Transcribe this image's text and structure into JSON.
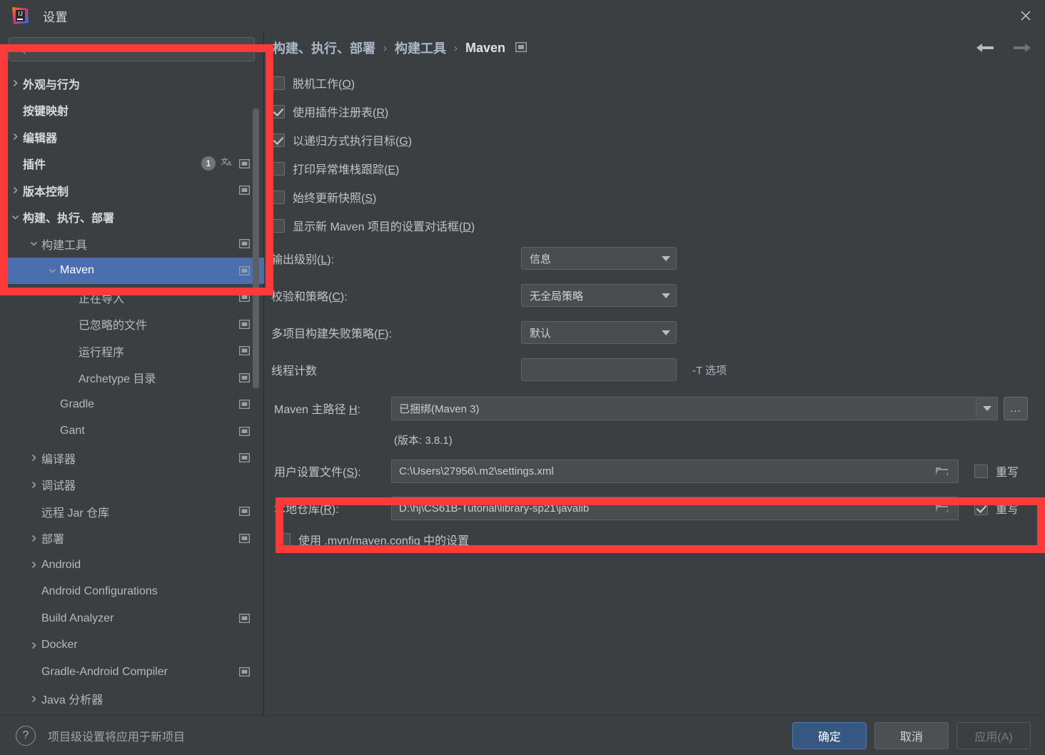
{
  "window": {
    "title": "设置",
    "close_icon": "close-icon",
    "logo": "intellij-idea-logo"
  },
  "sidebar": {
    "search": {
      "placeholder": "",
      "value": "",
      "icon": "search-icon"
    },
    "items": [
      {
        "label": "外观与行为",
        "indent": 0,
        "arrow": "collapsed",
        "bold": true,
        "badge": null,
        "translate": false,
        "scope_icon": false
      },
      {
        "label": "按键映射",
        "indent": 0,
        "arrow": "none",
        "bold": true,
        "badge": null,
        "translate": false,
        "scope_icon": false
      },
      {
        "label": "编辑器",
        "indent": 0,
        "arrow": "collapsed",
        "bold": true,
        "badge": null,
        "translate": false,
        "scope_icon": false
      },
      {
        "label": "插件",
        "indent": 0,
        "arrow": "none",
        "bold": true,
        "badge": "1",
        "translate": true,
        "scope_icon": true
      },
      {
        "label": "版本控制",
        "indent": 0,
        "arrow": "collapsed",
        "bold": true,
        "badge": null,
        "translate": false,
        "scope_icon": true
      },
      {
        "label": "构建、执行、部署",
        "indent": 0,
        "arrow": "expanded",
        "bold": true,
        "badge": null,
        "translate": false,
        "scope_icon": false
      },
      {
        "label": "构建工具",
        "indent": 1,
        "arrow": "expanded",
        "bold": false,
        "badge": null,
        "translate": false,
        "scope_icon": true
      },
      {
        "label": "Maven",
        "indent": 2,
        "arrow": "expanded",
        "bold": false,
        "badge": null,
        "translate": false,
        "scope_icon": true,
        "selected": true
      },
      {
        "label": "正在导入",
        "indent": 3,
        "arrow": "none",
        "bold": false,
        "badge": null,
        "translate": false,
        "scope_icon": true
      },
      {
        "label": "已忽略的文件",
        "indent": 3,
        "arrow": "none",
        "bold": false,
        "badge": null,
        "translate": false,
        "scope_icon": true
      },
      {
        "label": "运行程序",
        "indent": 3,
        "arrow": "none",
        "bold": false,
        "badge": null,
        "translate": false,
        "scope_icon": true
      },
      {
        "label": "Archetype 目录",
        "indent": 3,
        "arrow": "none",
        "bold": false,
        "badge": null,
        "translate": false,
        "scope_icon": true
      },
      {
        "label": "Gradle",
        "indent": 2,
        "arrow": "none",
        "bold": false,
        "badge": null,
        "translate": false,
        "scope_icon": true
      },
      {
        "label": "Gant",
        "indent": 2,
        "arrow": "none",
        "bold": false,
        "badge": null,
        "translate": false,
        "scope_icon": true
      },
      {
        "label": "编译器",
        "indent": 1,
        "arrow": "collapsed",
        "bold": false,
        "badge": null,
        "translate": false,
        "scope_icon": true
      },
      {
        "label": "调试器",
        "indent": 1,
        "arrow": "collapsed",
        "bold": false,
        "badge": null,
        "translate": false,
        "scope_icon": false
      },
      {
        "label": "远程 Jar 仓库",
        "indent": 1,
        "arrow": "none",
        "bold": false,
        "badge": null,
        "translate": false,
        "scope_icon": true
      },
      {
        "label": "部署",
        "indent": 1,
        "arrow": "collapsed",
        "bold": false,
        "badge": null,
        "translate": false,
        "scope_icon": true
      },
      {
        "label": "Android",
        "indent": 1,
        "arrow": "collapsed",
        "bold": false,
        "badge": null,
        "translate": false,
        "scope_icon": false
      },
      {
        "label": "Android Configurations",
        "indent": 1,
        "arrow": "none",
        "bold": false,
        "badge": null,
        "translate": false,
        "scope_icon": false
      },
      {
        "label": "Build Analyzer",
        "indent": 1,
        "arrow": "none",
        "bold": false,
        "badge": null,
        "translate": false,
        "scope_icon": true
      },
      {
        "label": "Docker",
        "indent": 1,
        "arrow": "collapsed",
        "bold": false,
        "badge": null,
        "translate": false,
        "scope_icon": false
      },
      {
        "label": "Gradle-Android Compiler",
        "indent": 1,
        "arrow": "none",
        "bold": false,
        "badge": null,
        "translate": false,
        "scope_icon": true
      },
      {
        "label": "Java 分析器",
        "indent": 1,
        "arrow": "collapsed",
        "bold": false,
        "badge": null,
        "translate": false,
        "scope_icon": false
      }
    ]
  },
  "breadcrumb": {
    "parts": [
      "构建、执行、部署",
      "构建工具",
      "Maven"
    ],
    "separator": "›",
    "scope_icon": "project-scope-icon",
    "back_icon": "back-arrow-icon",
    "forward_icon": "forward-arrow-icon"
  },
  "main": {
    "checkboxes": [
      {
        "label": "脱机工作",
        "mnemonic": "O",
        "checked": false
      },
      {
        "label": "使用插件注册表",
        "mnemonic": "R",
        "checked": true
      },
      {
        "label": "以递归方式执行目标",
        "mnemonic": "G",
        "checked": true
      },
      {
        "label": "打印异常堆栈跟踪",
        "mnemonic": "E",
        "checked": false
      },
      {
        "label": "始终更新快照",
        "mnemonic": "S",
        "checked": false
      },
      {
        "label": "显示新 Maven 项目的设置对话框",
        "mnemonic": "D",
        "checked": false
      }
    ],
    "combos": [
      {
        "label": "输出级别",
        "mnemonic": "L",
        "value": "信息"
      },
      {
        "label": "校验和策略",
        "mnemonic": "C",
        "value": "无全局策略"
      },
      {
        "label": "多项目构建失败策略",
        "mnemonic": "F",
        "value": "默认"
      }
    ],
    "thread_count": {
      "label": "线程计数",
      "value": "",
      "hint": "-T 选项"
    },
    "maven_home": {
      "label": "Maven 主路径",
      "mnemonic": "H",
      "value": "已捆绑(Maven 3)",
      "ellipsis_label": "...",
      "version_text": "(版本: 3.8.1)"
    },
    "user_settings": {
      "label": "用户设置文件",
      "mnemonic": "S",
      "value": "C:\\Users\\27956\\.m2\\settings.xml",
      "override_label": "重写",
      "override_checked": false
    },
    "local_repo": {
      "label": "本地仓库",
      "mnemonic": "R",
      "value": "D:\\hj\\CS61B-Tutorial\\library-sp21\\javalib",
      "override_label": "重写",
      "override_checked": true
    },
    "mvn_config_checkbox": {
      "label": "使用 .mvn/maven.config 中的设置",
      "checked": false
    }
  },
  "footer": {
    "help_icon": "question-mark-icon",
    "note": "项目级设置将应用于新项目",
    "ok_label": "确定",
    "cancel_label": "取消",
    "apply_label": "应用(A)"
  },
  "annotations": {
    "highlight_color": "#fd3a3a",
    "boxes": [
      "sidebar-tree-highlight",
      "local-repository-highlight"
    ]
  }
}
